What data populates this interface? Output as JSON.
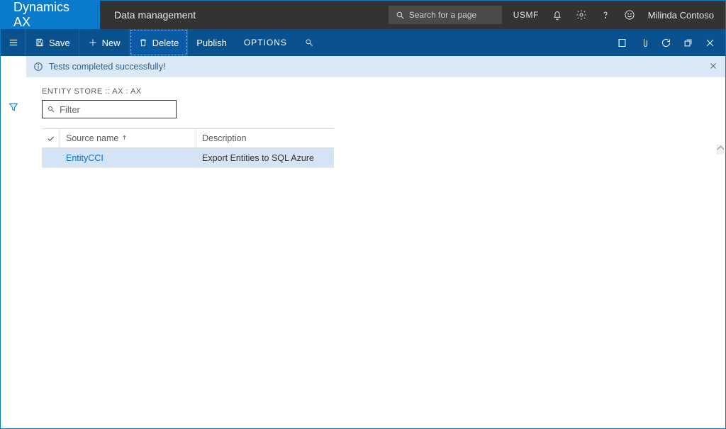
{
  "top": {
    "brand": "Dynamics AX",
    "workspace": "Data management",
    "search_placeholder": "Search for a page",
    "company": "USMF",
    "username": "Milinda Contoso"
  },
  "actions": {
    "save": "Save",
    "new": "New",
    "delete": "Delete",
    "publish": "Publish",
    "options": "OPTIONS"
  },
  "notification": {
    "message": "Tests completed successfully!"
  },
  "page": {
    "breadcrumb": "ENTITY STORE :: AX : AX",
    "filter_placeholder": "Filter"
  },
  "grid": {
    "columns": {
      "source_name": "Source name",
      "description": "Description"
    },
    "rows": [
      {
        "source_name": "EntityCCI",
        "description": "Export Entities to SQL Azure"
      }
    ]
  }
}
